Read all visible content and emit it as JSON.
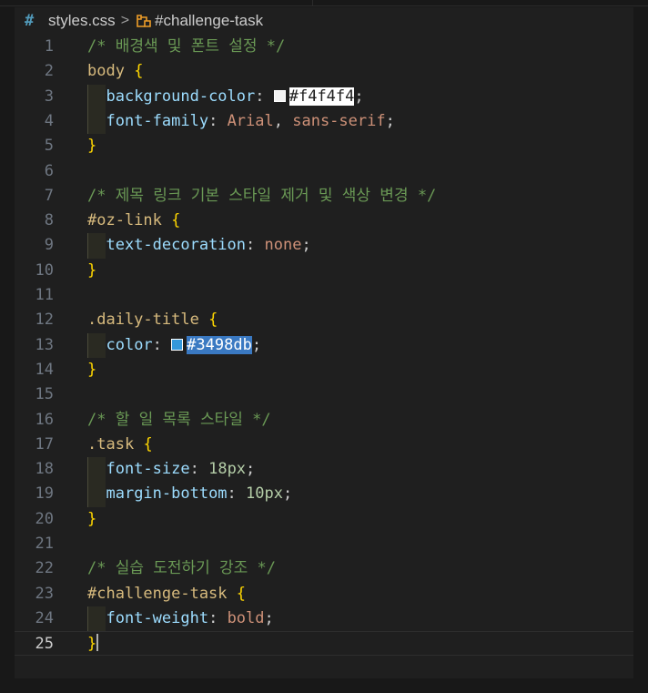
{
  "breadcrumb": {
    "file_icon": "css-hash-icon",
    "file": "styles.css",
    "separator": ">",
    "symbol_icon": "selector-symbol-icon",
    "symbol": "#challenge-task"
  },
  "editor": {
    "active_line": 25,
    "lines": [
      {
        "n": "1"
      },
      {
        "n": "2"
      },
      {
        "n": "3"
      },
      {
        "n": "4"
      },
      {
        "n": "5"
      },
      {
        "n": "6"
      },
      {
        "n": "7"
      },
      {
        "n": "8"
      },
      {
        "n": "9"
      },
      {
        "n": "10"
      },
      {
        "n": "11"
      },
      {
        "n": "12"
      },
      {
        "n": "13"
      },
      {
        "n": "14"
      },
      {
        "n": "15"
      },
      {
        "n": "16"
      },
      {
        "n": "17"
      },
      {
        "n": "18"
      },
      {
        "n": "19"
      },
      {
        "n": "20"
      },
      {
        "n": "21"
      },
      {
        "n": "22"
      },
      {
        "n": "23"
      },
      {
        "n": "24"
      },
      {
        "n": "25"
      }
    ],
    "code": {
      "l1": "/* 배경색 및 폰트 설정 */",
      "l2_sel": "body",
      "l3_prop": "background-color",
      "l3_val": "#f4f4f4",
      "l4_prop": "font-family",
      "l4_val1": "Arial",
      "l4_val2": "sans-serif",
      "l7": "/* 제목 링크 기본 스타일 제거 및 색상 변경 */",
      "l8_sel": "#oz-link",
      "l9_prop": "text-decoration",
      "l9_val": "none",
      "l12_sel": ".daily-title",
      "l13_prop": "color",
      "l13_val": "#3498db",
      "l16": "/* 할 일 목록 스타일 */",
      "l17_sel": ".task",
      "l18_prop": "font-size",
      "l18_val": "18px",
      "l19_prop": "margin-bottom",
      "l19_val": "10px",
      "l22": "/* 실습 도전하기 강조 */",
      "l23_sel": "#challenge-task",
      "l24_prop": "font-weight",
      "l24_val": "bold",
      "open": "{",
      "close": "}"
    },
    "colors": {
      "swatch_bg": "#f4f4f4",
      "swatch_blue": "#3498db"
    }
  }
}
